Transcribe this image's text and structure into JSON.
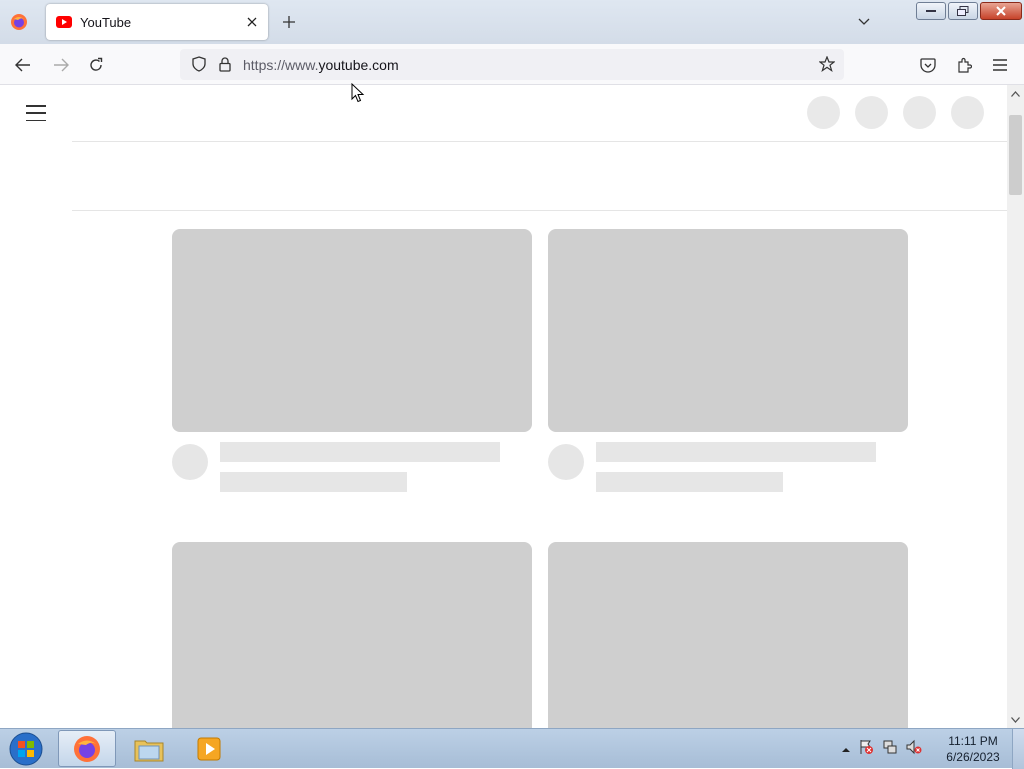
{
  "browser": {
    "tab": {
      "title": "YouTube"
    },
    "url": {
      "prefix": "https://www.",
      "domain": "youtube.com"
    }
  },
  "colors": {
    "accent": "#ff0000",
    "skeleton_thumb": "#cfcfcf",
    "skeleton_bar": "#e6e6e6"
  },
  "page": {
    "header_circles": 4,
    "cards": [
      {
        "state": "loading"
      },
      {
        "state": "loading"
      },
      {
        "state": "loading"
      },
      {
        "state": "loading"
      }
    ]
  },
  "taskbar": {
    "items": [
      "firefox-icon",
      "file-explorer-icon",
      "media-player-icon"
    ],
    "clock": {
      "time": "11:11 PM",
      "date": "6/26/2023"
    }
  }
}
